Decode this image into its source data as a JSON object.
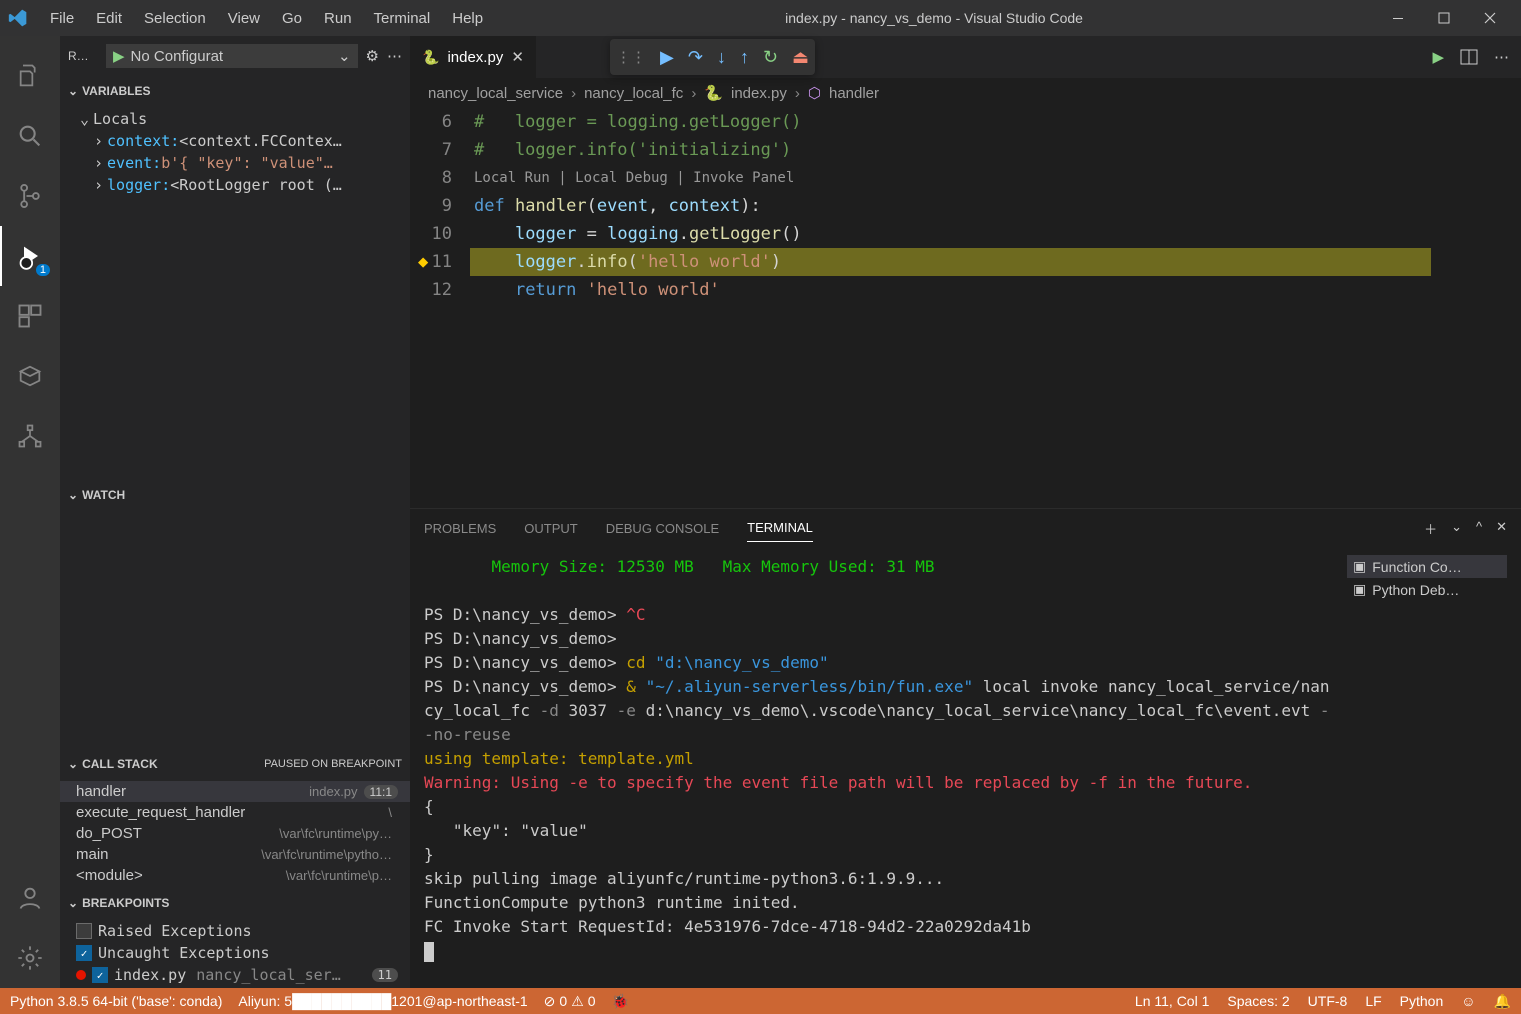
{
  "title": "index.py - nancy_vs_demo - Visual Studio Code",
  "menus": [
    "File",
    "Edit",
    "Selection",
    "View",
    "Go",
    "Run",
    "Terminal",
    "Help"
  ],
  "activity": {
    "debug_badge": "1"
  },
  "debug_header": {
    "run_label": "R…",
    "config": "No Configurat"
  },
  "sidebar": {
    "variables": {
      "title": "VARIABLES",
      "locals_label": "Locals",
      "rows": [
        {
          "name": "context:",
          "val": " <context.FCContex…"
        },
        {
          "name": "event:",
          "val": " b'{  \"key\": \"value\"…"
        },
        {
          "name": "logger:",
          "val": " <RootLogger root (…"
        }
      ]
    },
    "watch": {
      "title": "WATCH"
    },
    "callstack": {
      "title": "CALL STACK",
      "status": "PAUSED ON BREAKPOINT",
      "rows": [
        {
          "fn": "handler",
          "loc": "index.py",
          "ln": "11:1"
        },
        {
          "fn": "execute_request_handler",
          "loc": "\\"
        },
        {
          "fn": "do_POST",
          "loc": "\\var\\fc\\runtime\\py…"
        },
        {
          "fn": "main",
          "loc": "\\var\\fc\\runtime\\pytho…"
        },
        {
          "fn": "<module>",
          "loc": "\\var\\fc\\runtime\\p…"
        }
      ]
    },
    "breakpoints": {
      "title": "BREAKPOINTS",
      "rows": [
        {
          "label": "Raised Exceptions",
          "checked": false
        },
        {
          "label": "Uncaught Exceptions",
          "checked": true
        },
        {
          "label": "index.py",
          "sub": "nancy_local_ser…",
          "count": "11",
          "checked": true,
          "dot": true
        }
      ]
    }
  },
  "tabs": [
    {
      "label": "index.py"
    }
  ],
  "breadcrumbs": [
    "nancy_local_service",
    "nancy_local_fc",
    "index.py",
    "handler"
  ],
  "code": {
    "lines": [
      {
        "num": "6",
        "t": "comment",
        "text": "#   logger = logging.getLogger()"
      },
      {
        "num": "7",
        "t": "comment",
        "text": "#   logger.info('initializing')"
      },
      {
        "num": "8",
        "t": "blank",
        "text": ""
      },
      {
        "num": "",
        "t": "codelens",
        "text": "Local Run | Local Debug | Invoke Panel"
      },
      {
        "num": "9",
        "t": "def",
        "text": "def handler(event, context):"
      },
      {
        "num": "10",
        "t": "assign",
        "text": "    logger = logging.getLogger()"
      },
      {
        "num": "11",
        "t": "call",
        "text": "    logger.info('hello world')",
        "hl": true,
        "bp": true
      },
      {
        "num": "12",
        "t": "return",
        "text": "    return 'hello world'"
      }
    ]
  },
  "panel": {
    "tabs": [
      "PROBLEMS",
      "OUTPUT",
      "DEBUG CONSOLE",
      "TERMINAL"
    ],
    "active_tab": 3,
    "side": [
      "Function Co…",
      "Python Deb…"
    ],
    "terminal": {
      "header_mem": "Memory Size: 12530 MB   Max Memory Used: 31 MB",
      "lines": [
        {
          "seg": [
            {
              "c": "white",
              "t": "PS D:\\nancy_vs_demo> "
            },
            {
              "c": "red",
              "t": "^C"
            }
          ]
        },
        {
          "seg": [
            {
              "c": "white",
              "t": "PS D:\\nancy_vs_demo> "
            }
          ]
        },
        {
          "seg": [
            {
              "c": "white",
              "t": "PS D:\\nancy_vs_demo> "
            },
            {
              "c": "yellow",
              "t": "cd "
            },
            {
              "c": "cyan",
              "t": "\"d:\\nancy_vs_demo\""
            }
          ]
        },
        {
          "seg": [
            {
              "c": "white",
              "t": "PS D:\\nancy_vs_demo> "
            },
            {
              "c": "yellow",
              "t": "& "
            },
            {
              "c": "cyan",
              "t": "\"~/.aliyun-serverless/bin/fun.exe\""
            },
            {
              "c": "white",
              "t": " local invoke nancy_local_service/nancy_local_fc "
            },
            {
              "c": "gray",
              "t": "-d "
            },
            {
              "c": "white",
              "t": "3037 "
            },
            {
              "c": "gray",
              "t": "-e "
            },
            {
              "c": "white",
              "t": "d:\\nancy_vs_demo\\.vscode\\nancy_local_service\\nancy_local_fc\\event.evt "
            },
            {
              "c": "gray",
              "t": "--no-reuse"
            }
          ]
        },
        {
          "seg": [
            {
              "c": "yellow",
              "t": "using template: template.yml"
            }
          ]
        },
        {
          "seg": [
            {
              "c": "red",
              "t": "Warning: Using -e to specify the event file path will be replaced by -f in the future."
            }
          ]
        },
        {
          "seg": [
            {
              "c": "white",
              "t": "{"
            }
          ]
        },
        {
          "seg": [
            {
              "c": "white",
              "t": "   \"key\": \"value\""
            }
          ]
        },
        {
          "seg": [
            {
              "c": "white",
              "t": "}"
            }
          ]
        },
        {
          "seg": [
            {
              "c": "white",
              "t": "skip pulling image aliyunfc/runtime-python3.6:1.9.9..."
            }
          ]
        },
        {
          "seg": [
            {
              "c": "white",
              "t": "FunctionCompute python3 runtime inited."
            }
          ]
        },
        {
          "seg": [
            {
              "c": "white",
              "t": "FC Invoke Start RequestId: 4e531976-7dce-4718-94d2-22a0292da41b"
            }
          ]
        }
      ]
    }
  },
  "statusbar": {
    "python": "Python 3.8.5 64-bit ('base': conda)",
    "aliyun": "Aliyun: 5██████████1201@ap-northeast-1",
    "errors": "0",
    "warnings": "0",
    "ln": "Ln 11, Col 1",
    "spaces": "Spaces: 2",
    "enc": "UTF-8",
    "eol": "LF",
    "lang": "Python"
  }
}
